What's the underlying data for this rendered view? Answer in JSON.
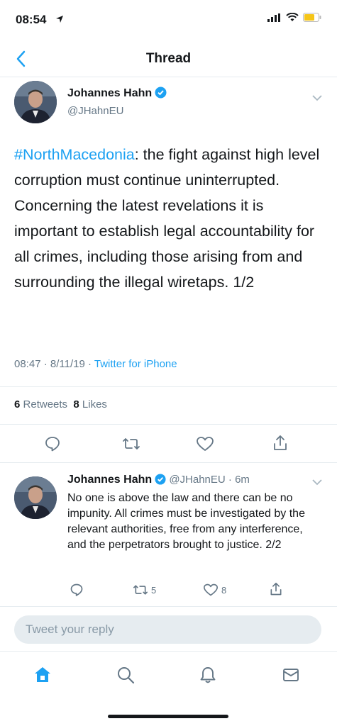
{
  "status_bar": {
    "time": "08:54"
  },
  "nav": {
    "title": "Thread",
    "back_icon": "chevron-left-icon"
  },
  "main_tweet": {
    "author_name": "Johannes Hahn",
    "author_handle": "@JHahnEU",
    "hashtag": "#NorthMacedonia",
    "text": ": the  fight against high level corruption must continue uninterrupted. Concerning the latest revelations it is important to establish legal accountability for all crimes, including those arising from and surrounding the illegal wiretaps. 1/2",
    "time": "08:47",
    "date": "8/11/19",
    "source": "Twitter for iPhone",
    "retweets_count": "6",
    "retweets_label": "Retweets",
    "likes_count": "8",
    "likes_label": "Likes"
  },
  "reply_tweet": {
    "author_name": "Johannes Hahn",
    "author_handle": "@JHahnEU",
    "age": "6m",
    "text": "No one is above the law and there can be no impunity. All crimes must be investigated by the relevant authorities, free from any interference, and the perpetrators brought to justice. 2/2",
    "retweet_count": "5",
    "like_count": "8"
  },
  "reply_box": {
    "placeholder": "Tweet your reply"
  },
  "tabs": [
    "home-icon",
    "search-icon",
    "notifications-icon",
    "messages-icon"
  ],
  "colors": {
    "accent": "#1da1f2",
    "text": "#14171a",
    "secondary": "#657786",
    "border": "#e6ecf0"
  }
}
